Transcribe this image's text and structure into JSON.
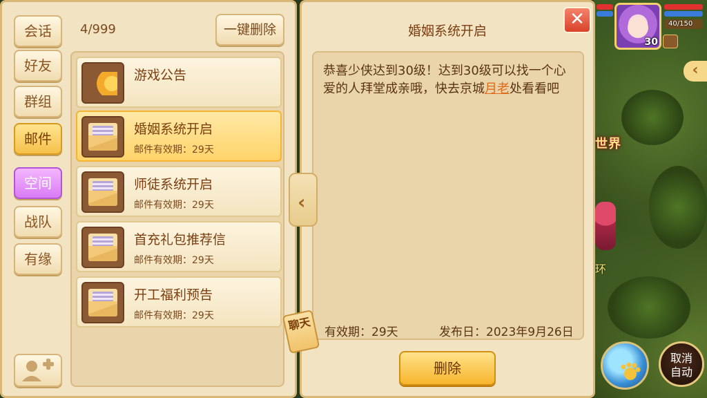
{
  "sidebar": {
    "tabs": [
      {
        "label": "会话"
      },
      {
        "label": "好友"
      },
      {
        "label": "群组"
      },
      {
        "label": "邮件"
      },
      {
        "label": "空间"
      },
      {
        "label": "战队"
      },
      {
        "label": "有缘"
      }
    ]
  },
  "mail_list": {
    "counter": "4/999",
    "delete_all_label": "一键删除",
    "items": [
      {
        "title": "游戏公告",
        "subtitle": ""
      },
      {
        "title": "婚姻系统开启",
        "subtitle": "邮件有效期：29天"
      },
      {
        "title": "师徒系统开启",
        "subtitle": "邮件有效期：29天"
      },
      {
        "title": "首充礼包推荐信",
        "subtitle": "邮件有效期：29天"
      },
      {
        "title": "开工福利预告",
        "subtitle": "邮件有效期：29天"
      }
    ]
  },
  "chat_tag": {
    "label": "聊天"
  },
  "detail": {
    "title": "婚姻系统开启",
    "close_label": "✕",
    "body_before": "恭喜少侠达到30级！达到30级可以找一个心爱的人拜堂成亲哦，快去京城",
    "body_link": "月老",
    "body_after": "处看看吧",
    "validity": "有效期：29天",
    "publish_date": "发布日：2023年9月26日",
    "delete_label": "删除"
  },
  "hud": {
    "player_level": "30",
    "hp_text": "40/150"
  },
  "scene": {
    "banner": "世界",
    "floating_text": "环"
  },
  "bottom_buttons": {
    "auto_label_line1": "取消",
    "auto_label_line2": "自动"
  },
  "colors": {
    "panel_bg": "#f2e3c3",
    "selected_item": "#ffd36a",
    "link": "#e36a1a",
    "close": "#d9422b"
  }
}
